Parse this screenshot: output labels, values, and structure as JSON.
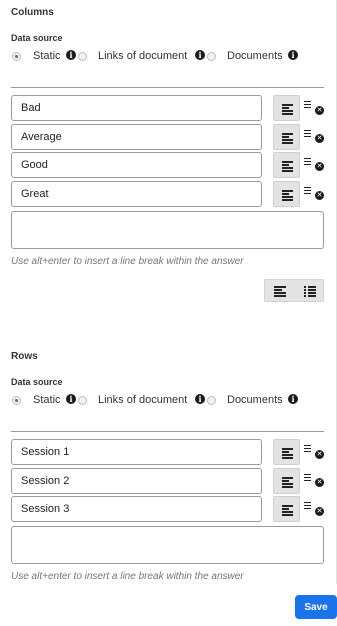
{
  "columns": {
    "title": "Columns",
    "data_source_label": "Data source",
    "options": [
      {
        "label": "Static",
        "selected": true
      },
      {
        "label": "Links of document",
        "selected": false
      },
      {
        "label": "Documents",
        "selected": false
      }
    ],
    "items": [
      "Bad",
      "Average",
      "Good",
      "Great"
    ],
    "new_item_value": "",
    "hint": "Use alt+enter to insert a line break within the answer"
  },
  "rows": {
    "title": "Rows",
    "data_source_label": "Data source",
    "options": [
      {
        "label": "Static",
        "selected": true
      },
      {
        "label": "Links of document",
        "selected": false
      },
      {
        "label": "Documents",
        "selected": false
      }
    ],
    "items": [
      "Session 1",
      "Session 2",
      "Session 3"
    ],
    "new_item_value": "",
    "hint": "Use alt+enter to insert a line break within the answer"
  },
  "icons": {
    "info": "info-icon",
    "align": "align-left-icon",
    "drag": "drag-handle-icon",
    "remove": "remove-icon",
    "list": "list-icon",
    "numbered_list": "numbered-list-icon"
  },
  "footer": {
    "save_label": "Save"
  },
  "colors": {
    "primary": "#1a73e8",
    "button_bg": "#e3e3e3",
    "border": "#9a9a9a"
  }
}
